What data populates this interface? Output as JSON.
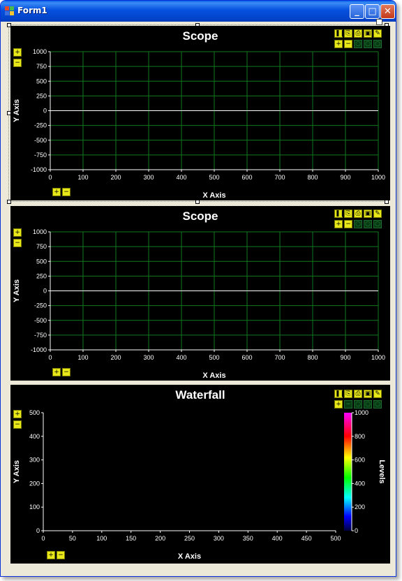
{
  "window": {
    "title": "Form1",
    "controls": {
      "minimize": "_",
      "maximize": "□",
      "close": "✕"
    }
  },
  "toolbar_icons": [
    "pause-icon",
    "copy-icon",
    "print-icon",
    "save-icon",
    "settings-icon",
    "zoom-in-icon",
    "zoom-out-icon",
    "zoom-icon",
    "zoom-icon",
    "zoom-icon"
  ],
  "scope1": {
    "title": "Scope",
    "xlabel": "X Axis",
    "ylabel": "Y Axis",
    "x_ticks": [
      "0",
      "100",
      "200",
      "300",
      "400",
      "500",
      "600",
      "700",
      "800",
      "900",
      "1000"
    ],
    "y_ticks": [
      "1000",
      "750",
      "500",
      "250",
      "0",
      "-250",
      "-500",
      "-750",
      "-1000"
    ]
  },
  "scope2": {
    "title": "Scope",
    "xlabel": "X Axis",
    "ylabel": "Y Axis",
    "x_ticks": [
      "0",
      "100",
      "200",
      "300",
      "400",
      "500",
      "600",
      "700",
      "800",
      "900",
      "1000"
    ],
    "y_ticks": [
      "1000",
      "750",
      "500",
      "250",
      "0",
      "-250",
      "-500",
      "-750",
      "-1000"
    ]
  },
  "waterfall": {
    "title": "Waterfall",
    "xlabel": "X Axis",
    "ylabel": "Y Axis",
    "levels_label": "Levels",
    "x_ticks": [
      "0",
      "50",
      "100",
      "150",
      "200",
      "250",
      "300",
      "350",
      "400",
      "450",
      "500"
    ],
    "y_ticks": [
      "500",
      "400",
      "300",
      "200",
      "100",
      "0"
    ],
    "level_ticks": [
      "1000",
      "800",
      "600",
      "400",
      "200",
      "0"
    ]
  },
  "colors": {
    "grid": "#0f7a1f",
    "axis": "#ffffff",
    "trace": "#ffffff",
    "button_active": "#e7e71a"
  }
}
